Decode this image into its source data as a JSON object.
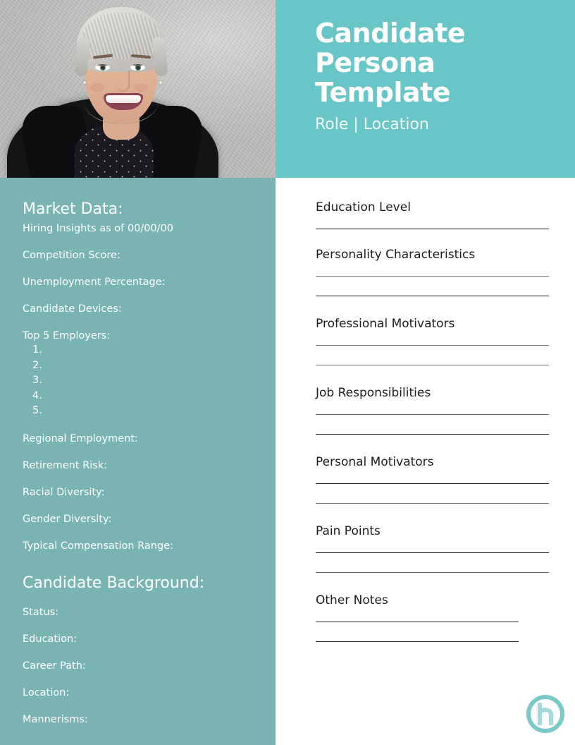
{
  "header": {
    "title_line1": "Candidate",
    "title_line2": "Persona",
    "title_line3": "Template",
    "subtitle": "Role | Location",
    "bg_color": "#68c6c6"
  },
  "photo": {
    "alt": "Smiling woman with short silver hair in black blazer",
    "bg_color": "#c6c6c4"
  },
  "sidebar": {
    "bg_color": "#79b4b3",
    "market_heading": "Market Data:",
    "market_subtitle": "Hiring Insights as of 00/00/00",
    "market_fields": [
      "Competition Score:",
      "Unemployment Percentage:",
      "Candidate Devices:"
    ],
    "employers_label": "Top 5 Employers:",
    "employers_list": [
      "1.",
      "2.",
      "3.",
      "4.",
      "5."
    ],
    "market_fields_2": [
      "Regional Employment:",
      "Retirement Risk:",
      "Racial Diversity:",
      "Gender Diversity:",
      "Typical Compensation Range:"
    ],
    "background_heading": "Candidate Background:",
    "background_fields": [
      "Status:",
      "Education:",
      "Career Path:",
      "Location:",
      "Mannerisms:"
    ]
  },
  "form": {
    "fields": [
      {
        "label": "Education Level",
        "lines": 1
      },
      {
        "label": "Personality Characteristics",
        "lines": 2
      },
      {
        "label": "Professional Motivators",
        "lines": 2
      },
      {
        "label": "Job Responsibilities",
        "lines": 2
      },
      {
        "label": "Personal Motivators",
        "lines": 2
      },
      {
        "label": "Pain Points",
        "lines": 2
      },
      {
        "label": "Other Notes",
        "lines": 2
      }
    ]
  },
  "logo": {
    "letter": "h",
    "color": "#6ec4c2",
    "color_light": "#a8dada"
  }
}
